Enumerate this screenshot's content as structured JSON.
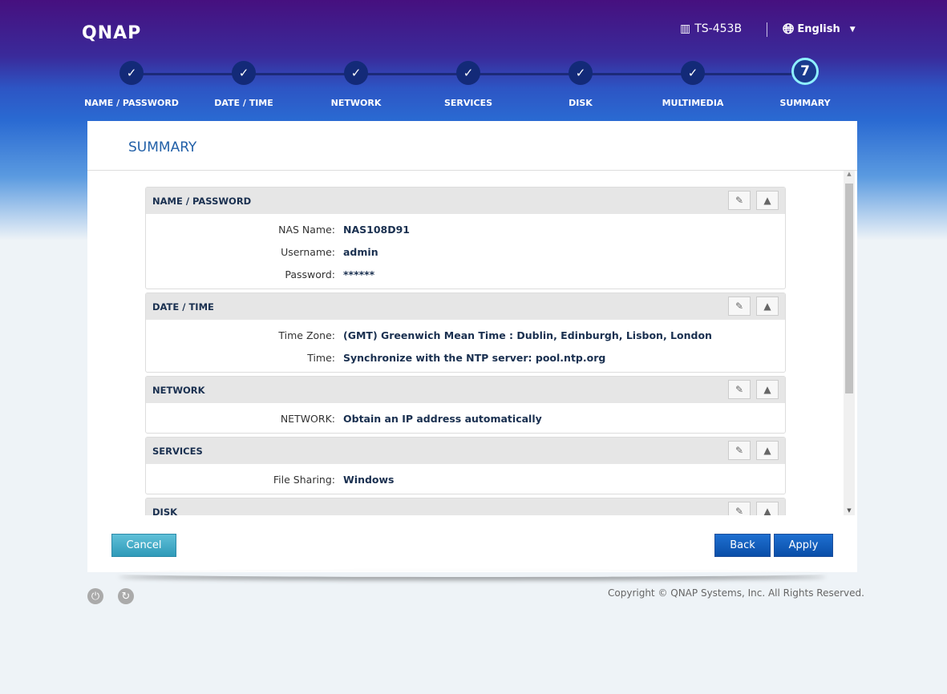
{
  "header": {
    "logo": "QNAP",
    "model": "TS-453B",
    "language": "English"
  },
  "steps": [
    {
      "label": "NAME / PASSWORD",
      "mark": "✓"
    },
    {
      "label": "DATE / TIME",
      "mark": "✓"
    },
    {
      "label": "NETWORK",
      "mark": "✓"
    },
    {
      "label": "SERVICES",
      "mark": "✓"
    },
    {
      "label": "DISK",
      "mark": "✓"
    },
    {
      "label": "MULTIMEDIA",
      "mark": "✓"
    },
    {
      "label": "SUMMARY",
      "mark": "7"
    }
  ],
  "panel": {
    "title": "SUMMARY"
  },
  "sections": [
    {
      "title": "NAME / PASSWORD",
      "rows": [
        {
          "label": "NAS Name:",
          "value": "NAS108D91"
        },
        {
          "label": "Username:",
          "value": "admin"
        },
        {
          "label": "Password:",
          "value": "******"
        }
      ]
    },
    {
      "title": "DATE / TIME",
      "rows": [
        {
          "label": "Time Zone:",
          "value": "(GMT) Greenwich Mean Time : Dublin, Edinburgh, Lisbon, London"
        },
        {
          "label": "Time:",
          "value": "Synchronize with the NTP server: pool.ntp.org"
        }
      ]
    },
    {
      "title": "NETWORK",
      "rows": [
        {
          "label": "NETWORK:",
          "value": "Obtain an IP address automatically"
        }
      ]
    },
    {
      "title": "SERVICES",
      "rows": [
        {
          "label": "File Sharing:",
          "value": "Windows"
        }
      ]
    },
    {
      "title": "DISK",
      "rows": []
    }
  ],
  "buttons": {
    "cancel": "Cancel",
    "back": "Back",
    "apply": "Apply"
  },
  "footer": {
    "copyright": "Copyright © QNAP Systems, Inc. All Rights Reserved."
  }
}
